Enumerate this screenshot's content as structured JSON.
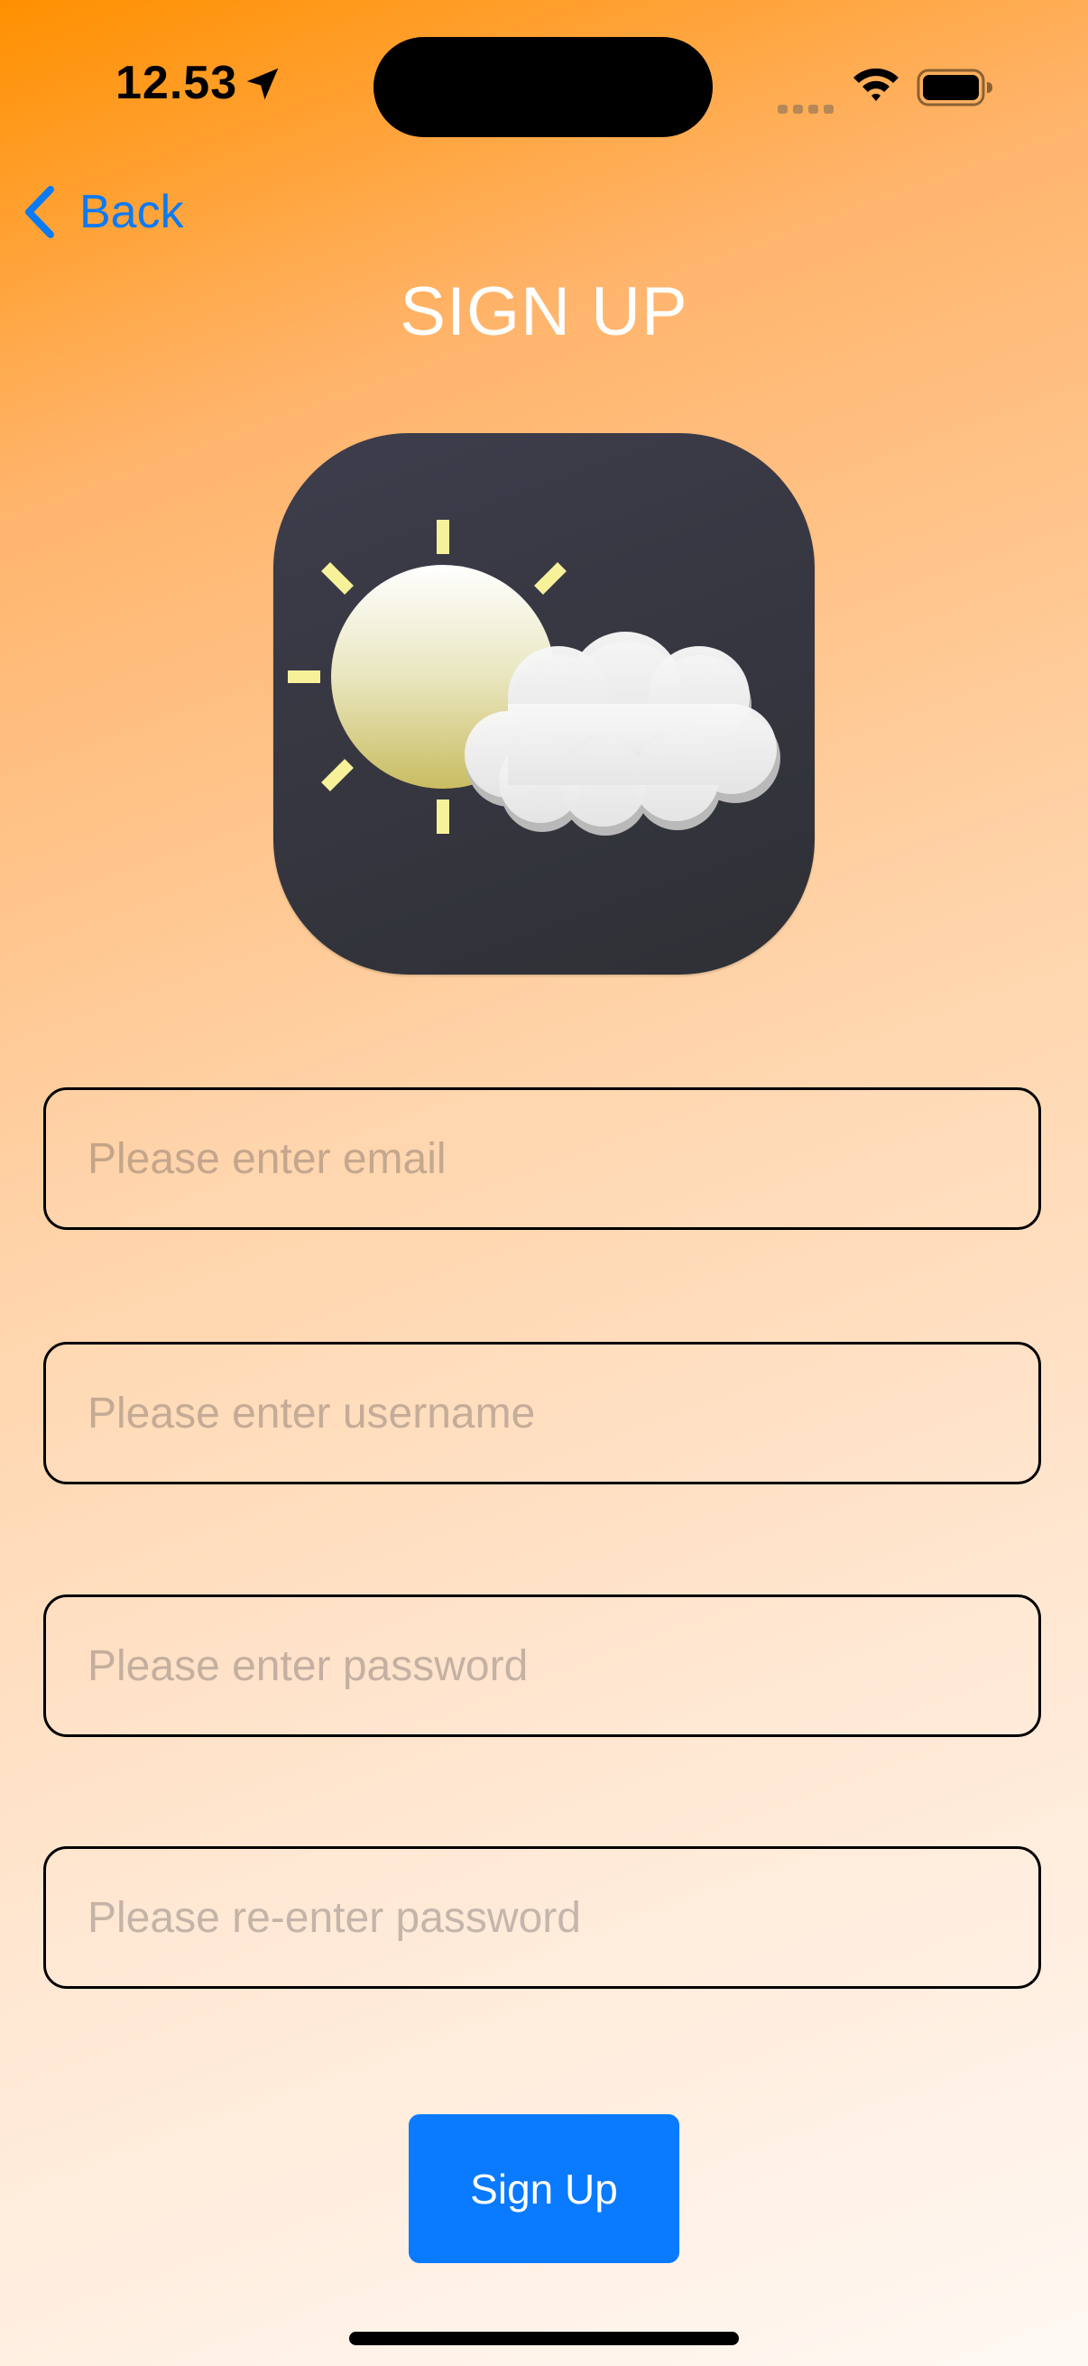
{
  "status_bar": {
    "time": "12.53",
    "icons": [
      "location-arrow-icon",
      "cellular-signal-icon",
      "wifi-icon",
      "battery-icon"
    ]
  },
  "nav": {
    "back_label": "Back",
    "back_icon": "chevron-left-icon"
  },
  "page": {
    "title": "SIGN UP"
  },
  "logo": {
    "icon": "sun-cloud-weather-icon"
  },
  "form": {
    "email_placeholder": "Please enter email",
    "username_placeholder": "Please enter username",
    "password_placeholder": "Please enter password",
    "confirm_password_placeholder": "Please re-enter password",
    "submit_label": "Sign Up"
  },
  "colors": {
    "accent": "#0A7AFF",
    "background_top": "#FF9000",
    "background_bottom": "#FFF8F3",
    "title": "#FFFFFF"
  }
}
